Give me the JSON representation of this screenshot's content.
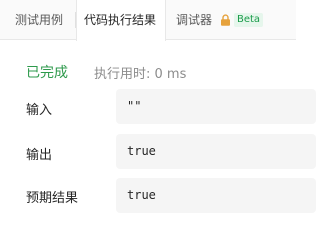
{
  "tabs": [
    {
      "label": "测试用例",
      "active": false
    },
    {
      "label": "代码执行结果",
      "active": true
    },
    {
      "label": "调试器",
      "active": false
    }
  ],
  "debugger_badge": "Beta",
  "debugger_icon": "lock-icon",
  "result": {
    "status": "已完成",
    "status_color": "#2e9a4c",
    "runtime": "执行用时: 0 ms"
  },
  "rows": [
    {
      "label": "输入",
      "value": "\"\""
    },
    {
      "label": "输出",
      "value": "true"
    },
    {
      "label": "预期结果",
      "value": "true"
    }
  ]
}
